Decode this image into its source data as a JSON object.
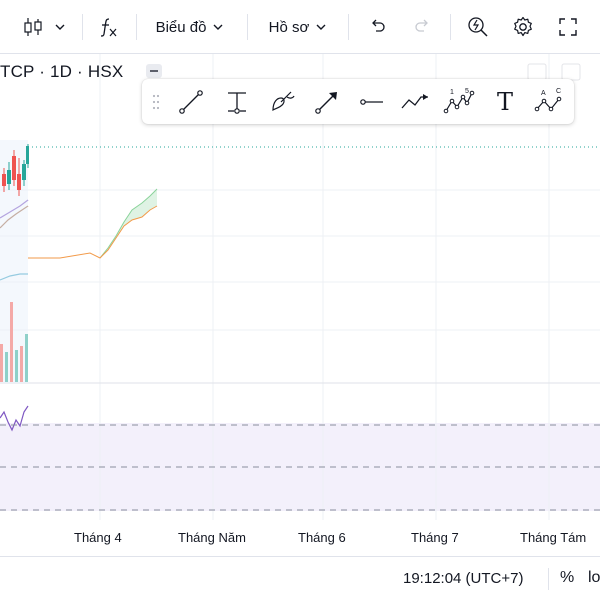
{
  "toolbar": {
    "chart_style_icon": "candles-icon",
    "indicators_icon": "function-icon",
    "chart_type_label": "Biểu đồ",
    "profile_label": "Hồ sơ",
    "undo_icon": "undo-icon",
    "redo_icon": "redo-icon",
    "quick_search_icon": "lightning-search-icon",
    "settings_icon": "gear-icon",
    "fullscreen_icon": "fullscreen-icon"
  },
  "symbol": {
    "text": "TCP · 1D · HSX"
  },
  "drawing_tools": [
    {
      "name": "trend-line-tool",
      "icon": "trend-line-icon"
    },
    {
      "name": "price-range-tool",
      "icon": "measure-icon"
    },
    {
      "name": "brush-tool",
      "icon": "brush-icon"
    },
    {
      "name": "arrow-tool",
      "icon": "arrow-icon"
    },
    {
      "name": "horizontal-ray-tool",
      "icon": "horizontal-ray-icon"
    },
    {
      "name": "path-tool",
      "icon": "path-icon"
    },
    {
      "name": "elliott-wave-tool",
      "icon": "elliott-wave-icon",
      "top_labels": [
        "1",
        "5"
      ]
    },
    {
      "name": "text-tool",
      "icon": "text-icon",
      "label": "T"
    },
    {
      "name": "abcd-pattern-tool",
      "icon": "abcd-icon",
      "top_labels": [
        "A",
        "C"
      ]
    }
  ],
  "time_axis": {
    "labels": [
      "Tháng 4",
      "Tháng Năm",
      "Tháng 6",
      "Tháng 7",
      "Tháng Tám"
    ]
  },
  "status": {
    "clock": "19:12:04 (UTC+7)",
    "percent_label": "%",
    "log_label": "lo"
  },
  "colors": {
    "up": "#26a69a",
    "down": "#ef5350",
    "ma_orange": "#f29a49",
    "ma_purple": "#7e57c2",
    "ma_teal": "#26a69a",
    "cloud_green": "#dff3e4",
    "subpane_bg": "#f3f0fb"
  }
}
